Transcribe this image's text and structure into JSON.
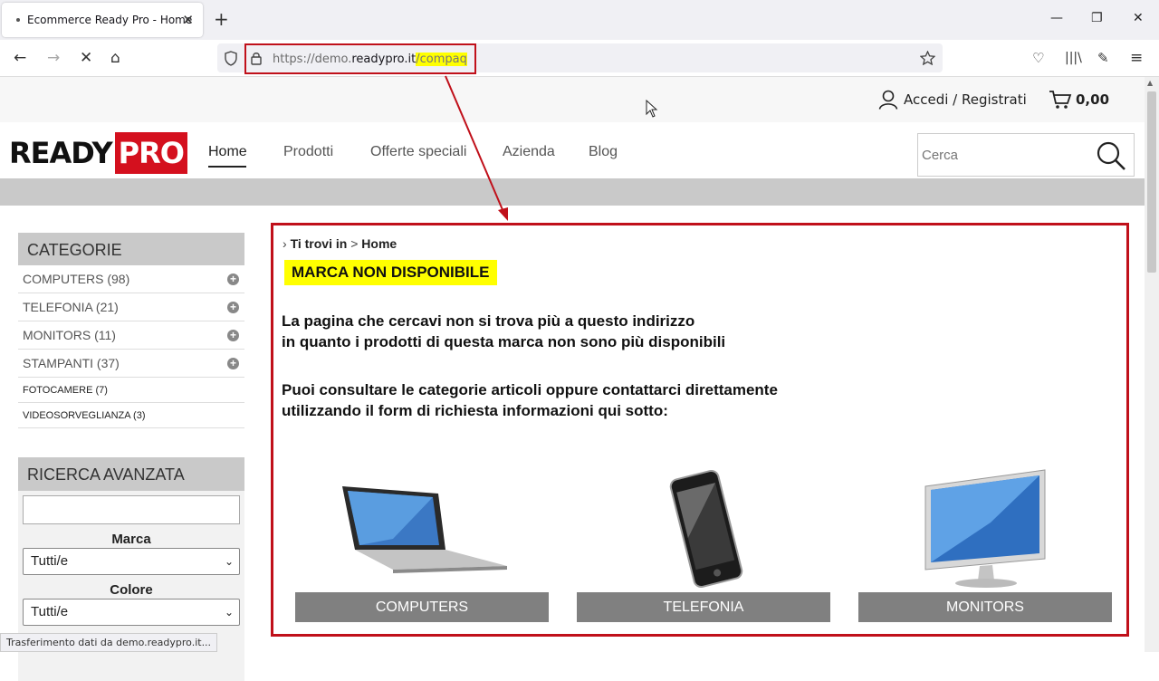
{
  "browser": {
    "tab_title": "Ecommerce Ready Pro - Home",
    "url_prefix": "https://demo.",
    "url_domain": "readypro.it",
    "url_path": "/compaq",
    "status": "Trasferimento dati da demo.readypro.it..."
  },
  "topbar": {
    "account_label": "Accedi / Registrati",
    "cart_total": "0,00"
  },
  "logo": {
    "part1": "READY",
    "part2": "PRO"
  },
  "nav": {
    "items": [
      "Home",
      "Prodotti",
      "Offerte speciali",
      "Azienda",
      "Blog"
    ]
  },
  "search": {
    "placeholder": "Cerca"
  },
  "sidebar": {
    "title": "CATEGORIE",
    "items": [
      {
        "label": "COMPUTERS (98)"
      },
      {
        "label": "TELEFONIA (21)"
      },
      {
        "label": "MONITORS (11)"
      },
      {
        "label": "STAMPANTI (37)"
      },
      {
        "label": "FOTOCAMERE (7)"
      },
      {
        "label": "VIDEOSORVEGLIANZA (3)"
      }
    ]
  },
  "advanced": {
    "title": "RICERCA AVANZATA",
    "marca_label": "Marca",
    "marca_value": "Tutti/e",
    "colore_label": "Colore",
    "colore_value": "Tutti/e"
  },
  "main": {
    "breadcrumb_label": "Ti trovi in",
    "breadcrumb_sep": ">",
    "breadcrumb_home": "Home",
    "headline": "MARCA NON DISPONIBILE",
    "msg1": "La pagina che cercavi non si trova più a questo indirizzo",
    "msg2": "in quanto i prodotti di questa marca non sono più disponibili",
    "msg3": "Puoi consultare le categorie articoli oppure contattarci direttamente",
    "msg4": "utilizzando il form di richiesta informazioni qui sotto:",
    "cards": [
      {
        "label": "COMPUTERS",
        "icon": "laptop-icon"
      },
      {
        "label": "TELEFONIA",
        "icon": "smartphone-icon"
      },
      {
        "label": "MONITORS",
        "icon": "monitor-icon"
      }
    ]
  },
  "colors": {
    "brand_red": "#d4101e",
    "highlight": "#ffff00",
    "annotation": "#c0101a",
    "button_gray": "#808080"
  }
}
